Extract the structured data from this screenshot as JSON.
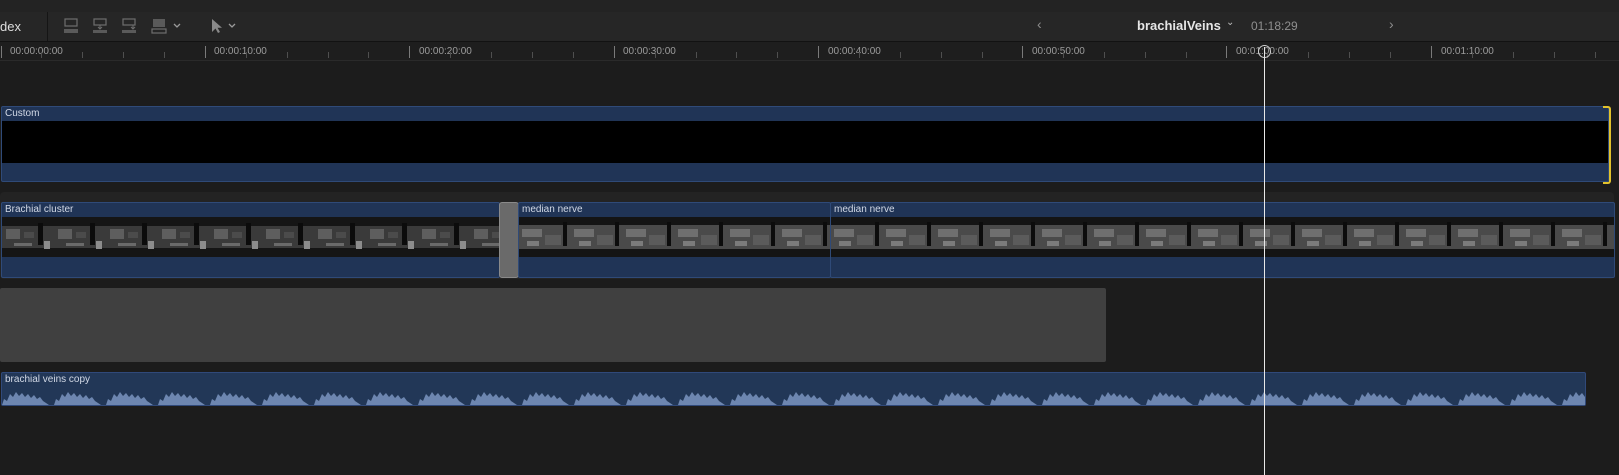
{
  "header": {
    "index_label": "dex",
    "project_name": "brachialVeins",
    "project_duration": "01:18:29",
    "prev_label": "‹",
    "next_label": "›",
    "chevron": "⌄"
  },
  "toolbar": {
    "icons": [
      "connect-clip-icon",
      "insert-clip-icon",
      "append-clip-icon",
      "overwrite-clip-icon",
      "select-tool-icon"
    ]
  },
  "ruler": {
    "labels": [
      "00:00:00:00",
      "00:00:10:00",
      "00:00:20:00",
      "00:00:30:00",
      "00:00:40:00",
      "00:00:50:00",
      "00:01:00:00",
      "00:01:10:00"
    ]
  },
  "timeline": {
    "custom_clip_label": "Custom",
    "video_clips": [
      "Brachial cluster",
      "median nerve",
      "median nerve"
    ],
    "audio_clip_label": "brachial veins copy"
  },
  "colors": {
    "clip_blue": "#203456",
    "selection_yellow": "#e2c22c",
    "playhead": "#e8e8e8"
  }
}
